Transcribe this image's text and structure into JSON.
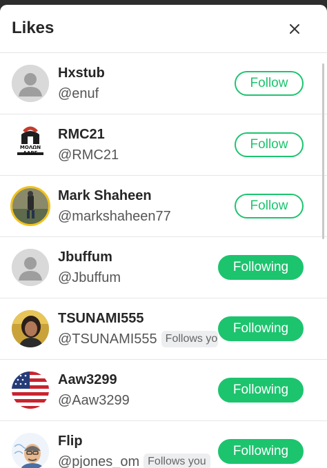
{
  "header": {
    "title": "Likes",
    "close_icon": "close-icon"
  },
  "colors": {
    "accent": "#1cc46e",
    "text": "#262626",
    "muted": "#555555"
  },
  "users": [
    {
      "display_name": "Hxstub",
      "handle": "@enuf",
      "button": "Follow",
      "follows_you": "",
      "avatar": "default-avatar-icon"
    },
    {
      "display_name": "RMC21",
      "handle": "@RMC21",
      "button": "Follow",
      "follows_you": "",
      "avatar": "spartan-helmet-avatar",
      "avatar_text": "ΜΟΛΩΝ ΛΑΒΕ"
    },
    {
      "display_name": "Mark Shaheen",
      "handle": "@markshaheen77",
      "button": "Follow",
      "follows_you": "",
      "avatar": "photo-avatar"
    },
    {
      "display_name": "Jbuffum",
      "handle": "@Jbuffum",
      "button": "Following",
      "follows_you": "",
      "avatar": "default-avatar-icon"
    },
    {
      "display_name": "TSUNAMI555",
      "handle": "@TSUNAMI555",
      "button": "Following",
      "follows_you": "Follows you",
      "avatar": "photo-avatar"
    },
    {
      "display_name": "Aaw3299",
      "handle": "@Aaw3299",
      "button": "Following",
      "follows_you": "",
      "avatar": "us-flag-avatar"
    },
    {
      "display_name": "Flip",
      "handle": "@pjones_om",
      "button": "Following",
      "follows_you": "Follows you",
      "avatar": "cartoon-avatar"
    }
  ]
}
